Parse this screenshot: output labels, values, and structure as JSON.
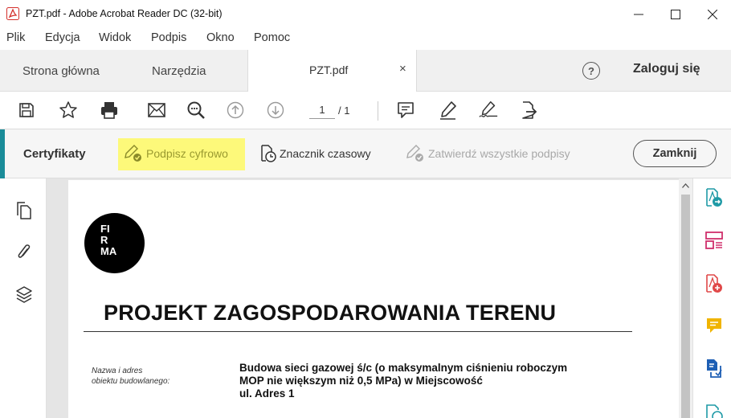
{
  "window": {
    "title": "PZT.pdf - Adobe Acrobat Reader DC (32-bit)",
    "controls": {
      "minimize": "—",
      "maximize": "☐",
      "close": "✕"
    }
  },
  "menu": [
    "Plik",
    "Edycja",
    "Widok",
    "Podpis",
    "Okno",
    "Pomoc"
  ],
  "tabs": {
    "home": "Strona główna",
    "tools": "Narzędzia",
    "document": "PZT.pdf",
    "close": "×",
    "help": "?",
    "signin": "Zaloguj się"
  },
  "toolbar": {
    "icons": [
      "save-icon",
      "star-icon",
      "print-icon",
      "mail-icon",
      "zoom-icon",
      "page-up-icon",
      "page-down-icon",
      "comment-icon",
      "highlight-pen-icon",
      "sign-icon",
      "share-icon"
    ],
    "page_current": "1",
    "page_total": "/ 1"
  },
  "certificates": {
    "title": "Certyfikaty",
    "sign_digitally": "Podpisz cyfrowo",
    "timestamp": "Znacznik czasowy",
    "validate_all": "Zatwierdź wszystkie podpisy",
    "close": "Zamknij",
    "accent_color": "#1a8c99",
    "highlight_color": "#fdf97a"
  },
  "document": {
    "logo_lines": [
      "FI",
      "R",
      "MA"
    ],
    "title": "PROJEKT ZAGOSPODAROWANIA TERENU",
    "label_line1": "Nazwa i adres",
    "label_line2": "obiektu budowlanego:",
    "investment_line1": "Budowa sieci gazowej ś/c (o maksymalnym ciśnieniu roboczym",
    "investment_line2": "MOP nie większym niż 0,5 MPa) w Miejscowość",
    "investment_line3": "ul. Adres 1"
  },
  "left_panel": [
    "pages-icon",
    "attachment-icon",
    "layers-icon"
  ],
  "right_panel": [
    "export-pdf-icon",
    "organize-pages-icon",
    "create-pdf-icon",
    "comment-tool-icon",
    "send-review-icon",
    "more-tools-icon"
  ]
}
